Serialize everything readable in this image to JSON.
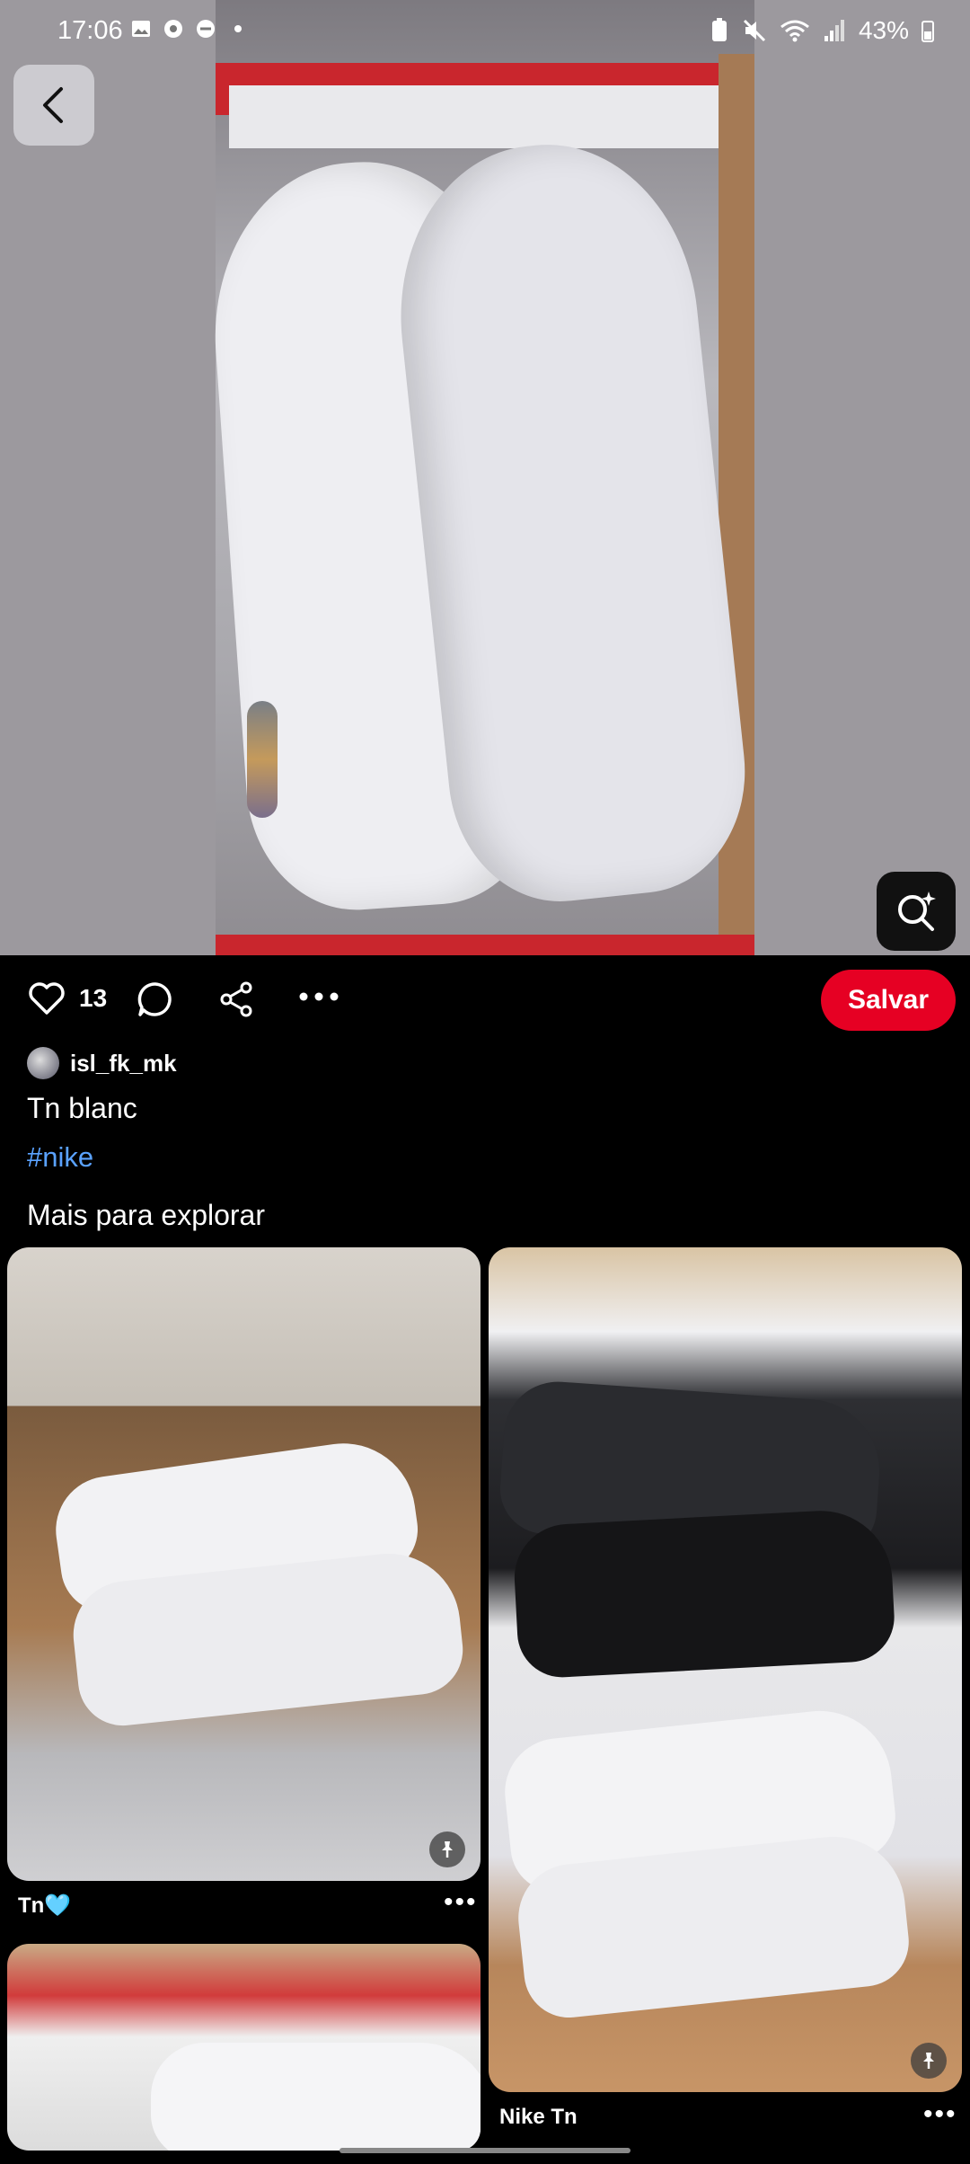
{
  "status_bar": {
    "time": "17:06",
    "battery": "43%"
  },
  "pin": {
    "like_count": "13",
    "save_label": "Salvar",
    "author": "isl_fk_mk",
    "title": "Tn blanc",
    "hashtag": "#nike"
  },
  "explore": {
    "heading": "Mais para explorar",
    "cards": [
      {
        "caption": "Tn🩵"
      },
      {
        "caption": "Nike Tn"
      },
      {
        "caption": ""
      }
    ]
  },
  "colors": {
    "save": "#e60023",
    "hashtag": "#5aa2ff",
    "background": "#000000"
  },
  "icons": [
    "back-arrow-icon",
    "visual-search-icon",
    "heart-icon",
    "comment-icon",
    "share-icon",
    "more-icon",
    "pin-icon"
  ]
}
